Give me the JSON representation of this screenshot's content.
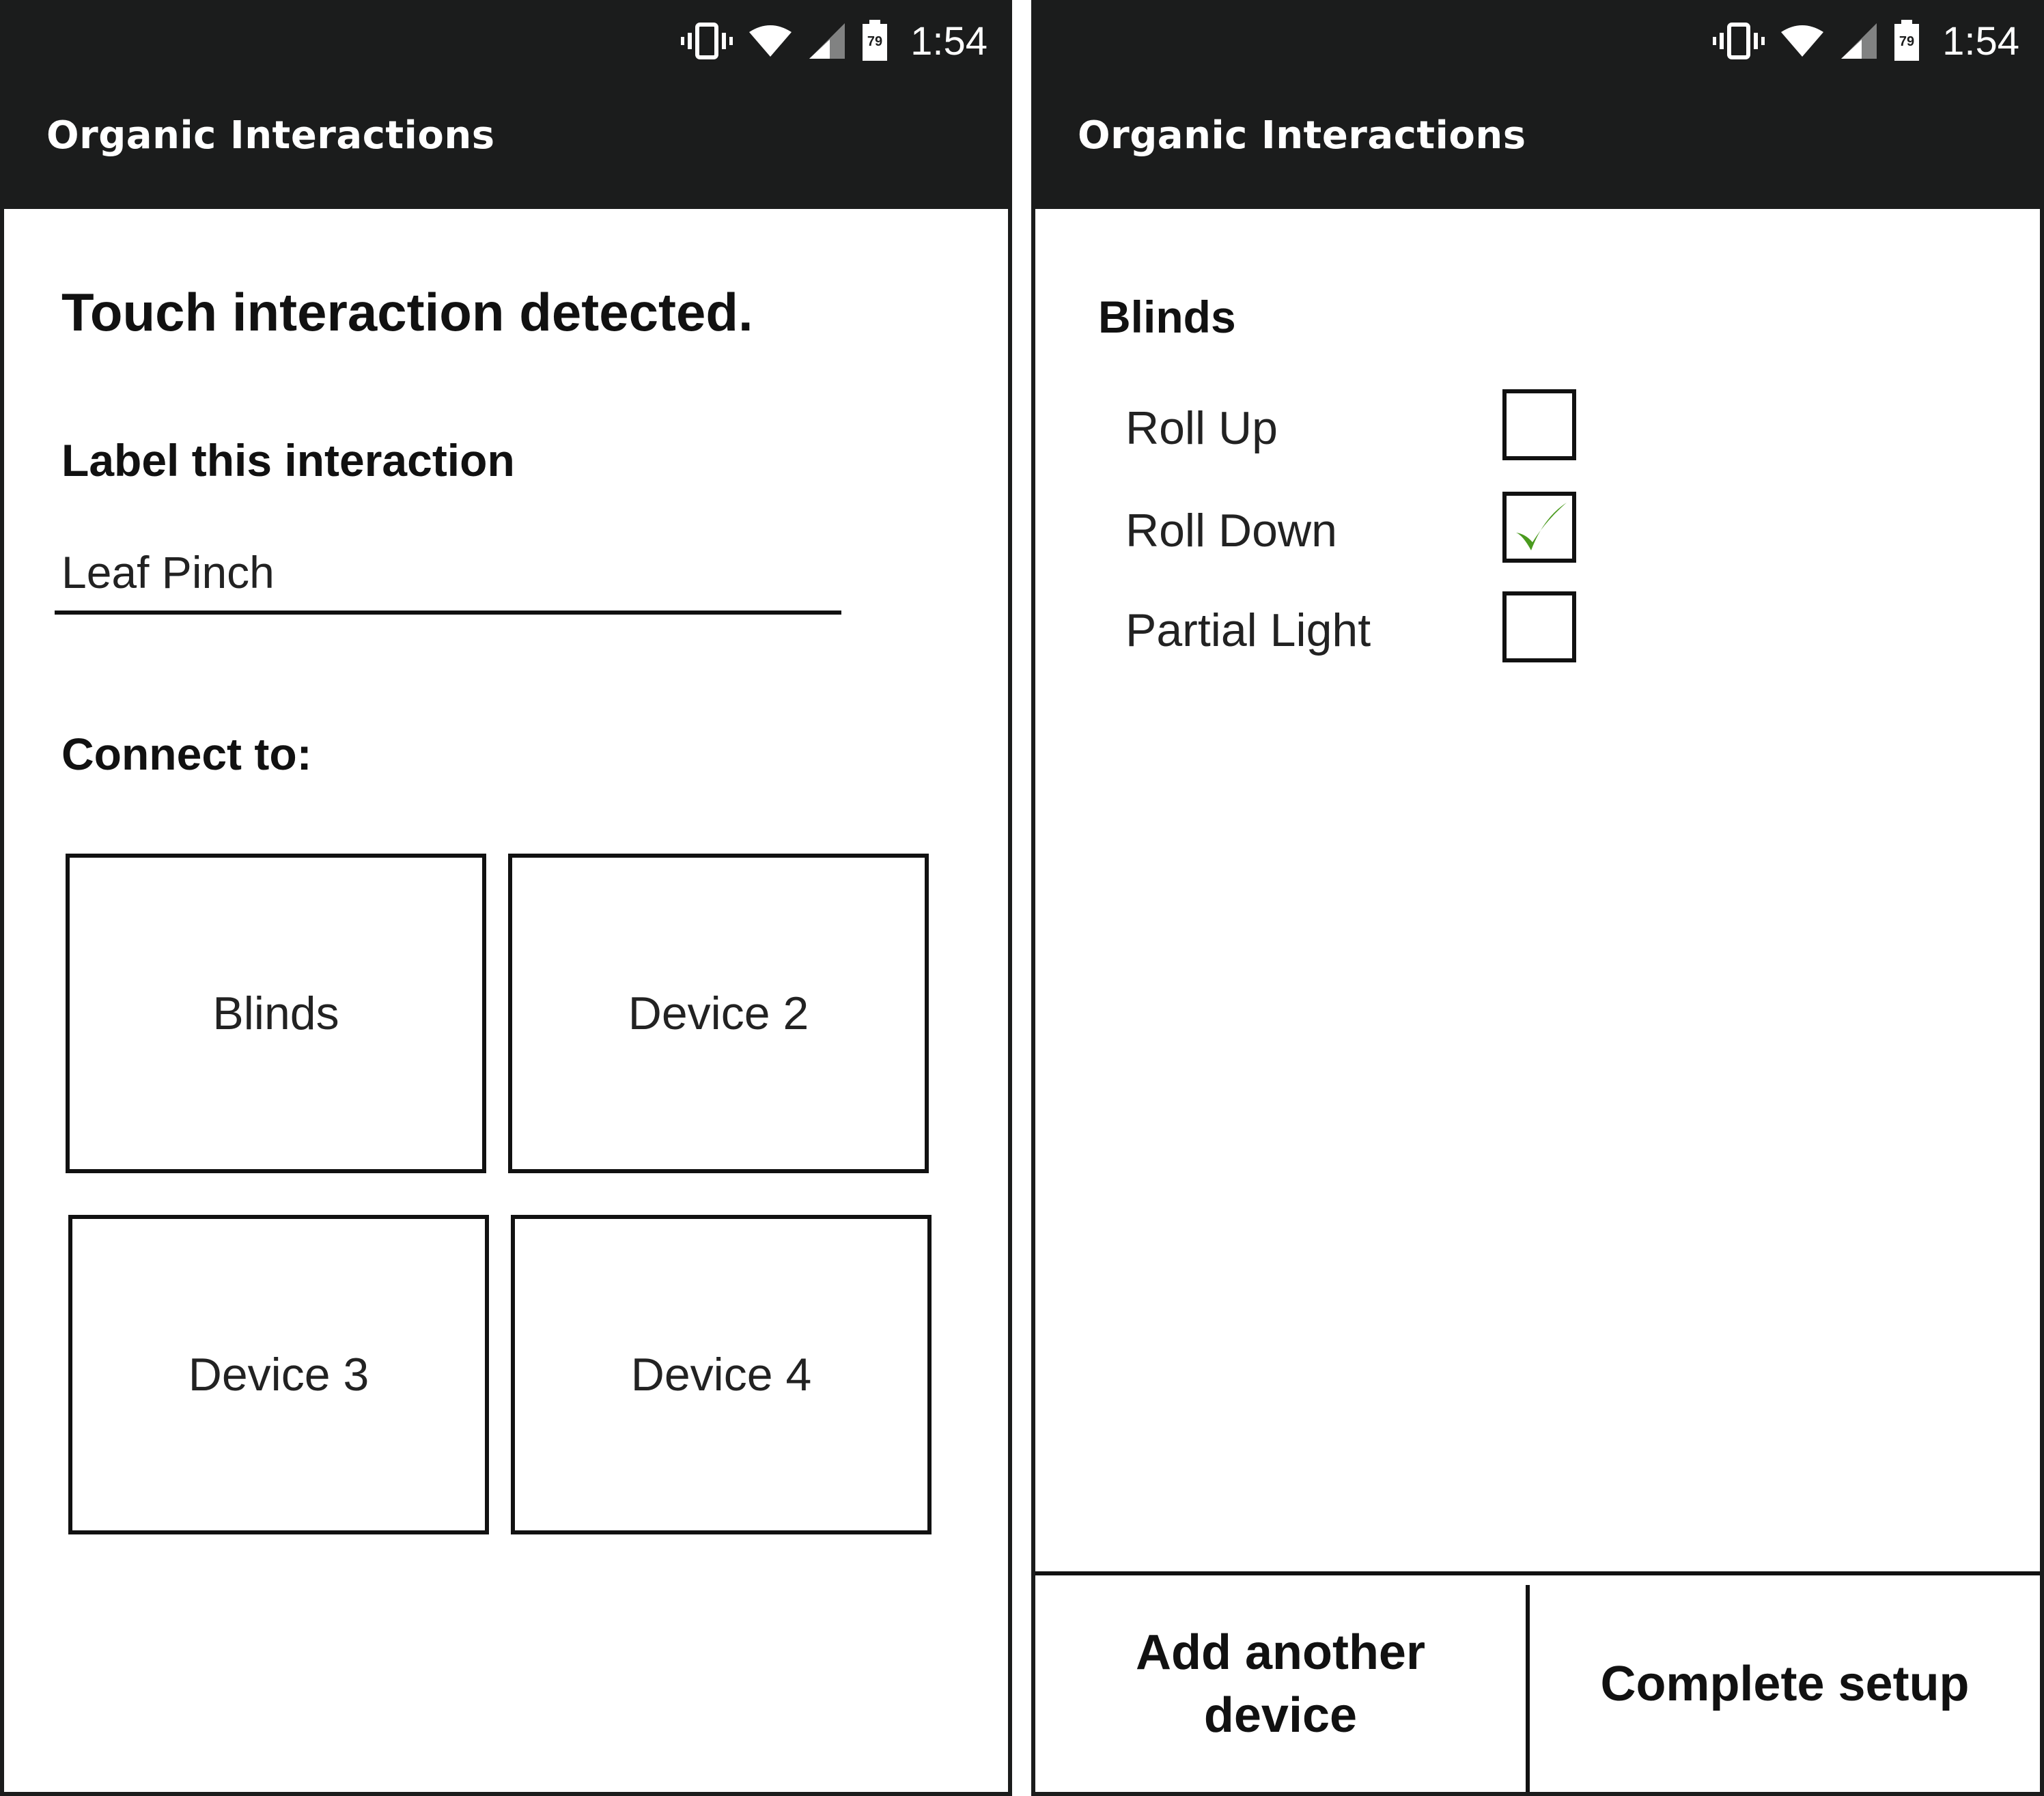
{
  "status_bar": {
    "time": "1:54",
    "battery_level": "79",
    "icons": [
      "vibrate-icon",
      "wifi-icon",
      "cell-signal-icon",
      "battery-icon"
    ]
  },
  "left_screen": {
    "app_title": "Organic Interactions",
    "heading": "Touch interaction detected.",
    "label_prompt": "Label this interaction",
    "label_value": "Leaf Pinch",
    "connect_label": "Connect to:",
    "devices": [
      "Blinds",
      "Device 2",
      "Device 3",
      "Device 4"
    ]
  },
  "right_screen": {
    "app_title": "Organic Interactions",
    "device_name": "Blinds",
    "options": [
      {
        "label": "Roll Up",
        "checked": false
      },
      {
        "label": "Roll Down",
        "checked": true
      },
      {
        "label": "Partial Light",
        "checked": false
      }
    ],
    "check_color": "#4a9a1e",
    "add_button_line1": "Add another",
    "add_button_line2": "device",
    "complete_button": "Complete setup"
  },
  "colors": {
    "appbar": "#1b1c1c",
    "text_primary": "#111111"
  }
}
